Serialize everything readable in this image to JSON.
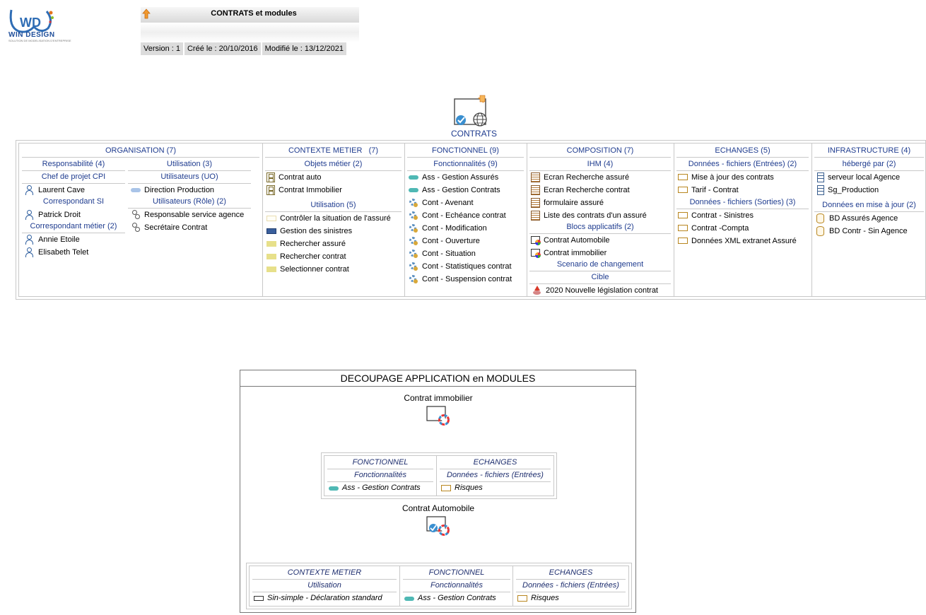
{
  "logo": {
    "text": "WIN DESIGN",
    "tagline": "SOLUTION DE MODELISATION D'ENTREPRISE"
  },
  "header": {
    "title": "CONTRATS et modules",
    "version": "Version : 1",
    "created": "Créé le : 20/10/2016",
    "modified": "Modifié le : 13/12/2021"
  },
  "main": {
    "label": "CONTRATS"
  },
  "columns": {
    "organisation": {
      "title": "ORGANISATION (7)",
      "resp_title": "Responsabilité (4)",
      "util_title": "Utilisation (3)",
      "chef_title": "Chef de projet CPI",
      "chef_items": [
        "Laurent Cave"
      ],
      "corr_si_title": "Correspondant SI",
      "corr_si_items": [
        "Patrick Droit"
      ],
      "corr_metier_title": "Correspondant métier (2)",
      "corr_metier_items": [
        "Annie Etoile",
        "Elisabeth Telet"
      ],
      "uo_title": "Utilisateurs (UO)",
      "uo_items": [
        "Direction Production"
      ],
      "role_title": "Utilisateurs (Rôle) (2)",
      "role_items": [
        "Responsable service agence",
        "Secrétaire Contrat"
      ]
    },
    "contexte": {
      "title": "CONTEXTE METIER   (7)",
      "objets_title": "Objets métier (2)",
      "objets_items": [
        "Contrat auto",
        "Contrat Immobilier"
      ],
      "util_title": "Utilisation (5)",
      "util_items": [
        "Contrôler la situation de l'assuré",
        "Gestion des sinistres",
        "Rechercher assuré",
        "Rechercher contrat",
        "Selectionner contrat"
      ]
    },
    "fonctionnel": {
      "title": "FONCTIONNEL (9)",
      "fonct_title": "Fonctionnalités (9)",
      "items": [
        "Ass - Gestion Assurés",
        "Ass - Gestion Contrats",
        "Cont - Avenant",
        "Cont - Echéance contrat",
        "Cont - Modification",
        "Cont - Ouverture",
        "Cont - Situation",
        "Cont - Statistiques contrat",
        "Cont - Suspension contrat"
      ]
    },
    "composition": {
      "title": "COMPOSITION (7)",
      "ihm_title": "IHM (4)",
      "ihm_items": [
        "Ecran Recherche assuré",
        "Ecran Recherche contrat",
        "formulaire assuré",
        "Liste des contrats d'un assuré"
      ],
      "blocs_title": "Blocs applicatifs (2)",
      "blocs_items": [
        "Contrat Automobile",
        "Contrat immobilier"
      ],
      "scenario_title": "Scenario de changement",
      "cible_title": "Cible",
      "cible_items": [
        "2020 Nouvelle législation contrat"
      ]
    },
    "echanges": {
      "title": "ECHANGES (5)",
      "entrees_title": "Données - fichiers (Entrées) (2)",
      "entrees_items": [
        "Mise à jour des contrats",
        "Tarif - Contrat"
      ],
      "sorties_title": "Données - fichiers (Sorties) (3)",
      "sorties_items": [
        "Contrat - Sinistres",
        "Contrat -Compta",
        "Données XML extranet Assuré"
      ]
    },
    "infrastructure": {
      "title": "INFRASTRUCTURE (4)",
      "heberge_title": "hébergé par (2)",
      "heberge_items": [
        "serveur local  Agence",
        "Sg_Production"
      ],
      "donnees_title": "Données en mise à jour (2)",
      "donnees_items": [
        "BD Assurés Agence",
        "BD Contr - Sin Agence"
      ]
    }
  },
  "modules": {
    "title": "DECOUPAGE APPLICATION en MODULES",
    "m1": {
      "label": "Contrat immobilier",
      "fonctionnel": "FONCTIONNEL",
      "fonct_sub": "Fonctionnalités",
      "fonct_item": "Ass - Gestion Contrats",
      "echanges": "ECHANGES",
      "ech_sub": "Données - fichiers (Entrées)",
      "ech_item": "Risques"
    },
    "m2": {
      "label": "Contrat Automobile",
      "contexte": "CONTEXTE METIER",
      "ctx_sub": "Utilisation",
      "ctx_item": "Sin-simple - Déclaration standard",
      "fonctionnel": "FONCTIONNEL",
      "fonct_sub": "Fonctionnalités",
      "fonct_item": "Ass - Gestion Contrats",
      "echanges": "ECHANGES",
      "ech_sub": "Données - fichiers (Entrées)",
      "ech_item": "Risques"
    }
  }
}
